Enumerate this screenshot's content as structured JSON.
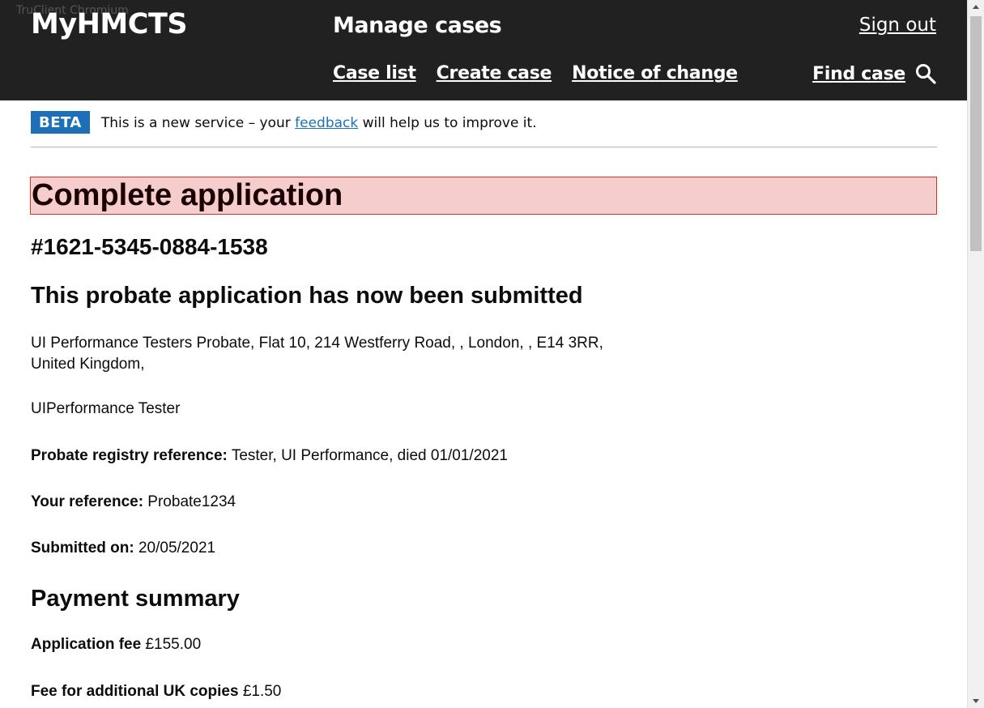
{
  "browser": {
    "tooltip": "TruClient Chromium"
  },
  "header": {
    "logo": "MyHMCTS",
    "service_name": "Manage cases",
    "sign_out": "Sign out",
    "nav": {
      "case_list": "Case list",
      "create_case": "Create case",
      "notice_of_change": "Notice of change",
      "find_case": "Find case"
    }
  },
  "phase_banner": {
    "tag": "BETA",
    "text_before": "This is a new service – your ",
    "link": "feedback",
    "text_after": " will help us to improve it."
  },
  "main": {
    "page_title": "Complete application",
    "case_number": "#1621-5345-0884-1538",
    "submitted_heading": "This probate application has now been submitted",
    "address_line1": "UI Performance Testers Probate, Flat 10, 214 Westferry Road, , London, , E14 3RR,",
    "address_line2": "United Kingdom,",
    "person_name": "UIPerformance Tester",
    "registry_label": "Probate registry reference:",
    "registry_value": " Tester, UI Performance, died 01/01/2021",
    "your_reference_label": "Your reference:",
    "your_reference_value": " Probate1234",
    "submitted_on_label": "Submitted on:",
    "submitted_on_value": " 20/05/2021",
    "payment_heading": "Payment summary",
    "application_fee_label": "Application fee",
    "application_fee_value": " £155.00",
    "uk_copies_label": "Fee for additional UK copies",
    "uk_copies_value": " £1.50"
  },
  "colors": {
    "header_bg": "#212121",
    "beta_tag": "#1d70b8",
    "link": "#1d70b8",
    "error_title_bg": "#f6cdcd",
    "error_title_border": "#d4351c"
  }
}
